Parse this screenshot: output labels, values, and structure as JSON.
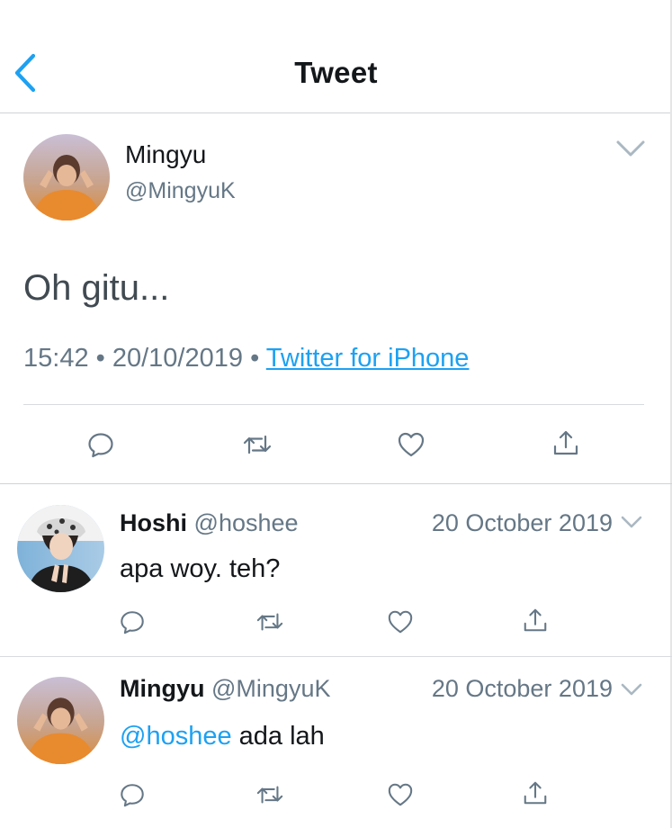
{
  "nav": {
    "title": "Tweet"
  },
  "tweet": {
    "name": "Mingyu",
    "handle": "@MingyuK",
    "text": "Oh gitu...",
    "time": "15:42",
    "date": "20/10/2019",
    "source": "Twitter for iPhone",
    "dot": "•"
  },
  "replies": [
    {
      "name": "Hoshi",
      "handle": "@hoshee",
      "date": "20 October 2019",
      "text": "apa woy. teh?"
    },
    {
      "name": "Mingyu",
      "handle": "@MingyuK",
      "date": "20 October 2019",
      "mention": "@hoshee",
      "text": " ada lah"
    }
  ],
  "colors": {
    "accent": "#1da1f2",
    "secondary_text": "#657786",
    "icon": "#657786",
    "divider": "#d8dbde"
  },
  "icons": [
    "back-chevron-icon",
    "chevron-down-icon",
    "reply-icon",
    "retweet-icon",
    "like-icon",
    "share-icon"
  ]
}
